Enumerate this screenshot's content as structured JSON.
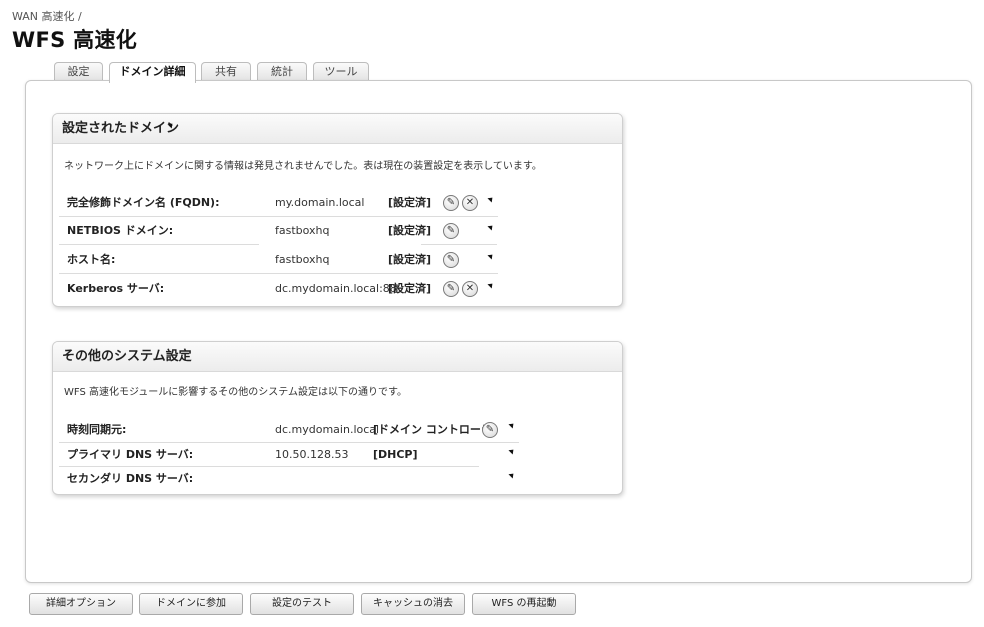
{
  "breadcrumb": "WAN 高速化 /",
  "title": "WFS 高速化",
  "tabs": [
    {
      "label": "設定",
      "active": false
    },
    {
      "label": "ドメイン詳細",
      "active": true
    },
    {
      "label": "共有",
      "active": false
    },
    {
      "label": "統計",
      "active": false
    },
    {
      "label": "ツール",
      "active": false
    }
  ],
  "domains_section": {
    "title": "設定されたドメイン",
    "description": "ネットワーク上にドメインに関する情報は発見されませんでした。表は現在の装置設定を表示しています。",
    "rows": [
      {
        "label": "完全修飾ドメイン名 (FQDN):",
        "value": "my.domain.local",
        "status": "[設定済]",
        "icons": [
          "edit-icon",
          "delete-icon"
        ]
      },
      {
        "label": "NETBIOS ドメイン:",
        "value": "fastboxhq",
        "status": "[設定済]",
        "icons": [
          "edit-icon"
        ]
      },
      {
        "label": "ホスト名:",
        "value": "fastboxhq",
        "status": "[設定済]",
        "icons": [
          "edit-icon"
        ]
      },
      {
        "label": "Kerberos サーバ:",
        "value": "dc.mydomain.local:88",
        "status": "[設定済]",
        "icons": [
          "edit-icon",
          "delete-icon"
        ]
      }
    ]
  },
  "system_section": {
    "title": "その他のシステム設定",
    "description": "WFS 高速化モジュールに影響するその他のシステム設定は以下の通りです。",
    "rows": [
      {
        "label": "時刻同期元:",
        "value": "dc.mydomain.local",
        "status": "[ドメイン コントローラ]",
        "icons": [
          "edit-icon"
        ]
      },
      {
        "label": "プライマリ DNS サーバ:",
        "value": "10.50.128.53",
        "status": "[DHCP]",
        "icons": []
      },
      {
        "label": "セカンダリ DNS サーバ:",
        "value": "",
        "status": "",
        "icons": []
      }
    ]
  },
  "icons": {
    "edit-icon": "✎",
    "delete-icon": "✕"
  },
  "buttons": [
    "詳細オプション",
    "ドメインに参加",
    "設定のテスト",
    "キャッシュの消去",
    "WFS の再起動"
  ]
}
